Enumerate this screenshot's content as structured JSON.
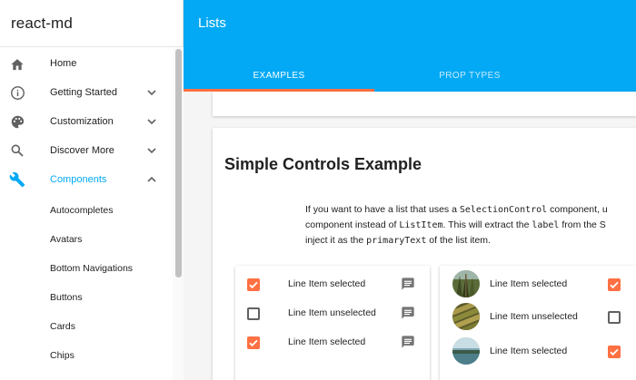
{
  "app": {
    "title": "react-md"
  },
  "sidebar": {
    "items": [
      {
        "label": "Home",
        "icon": "home-icon"
      },
      {
        "label": "Getting Started",
        "icon": "info-icon",
        "expand": "chevron-down-icon"
      },
      {
        "label": "Customization",
        "icon": "palette-icon",
        "expand": "chevron-down-icon"
      },
      {
        "label": "Discover More",
        "icon": "search-icon",
        "expand": "chevron-down-icon"
      },
      {
        "label": "Components",
        "icon": "wrench-icon",
        "expand": "chevron-up-icon",
        "active": true
      }
    ],
    "subitems": [
      "Autocompletes",
      "Avatars",
      "Bottom Navigations",
      "Buttons",
      "Cards",
      "Chips"
    ]
  },
  "header": {
    "title": "Lists",
    "tabs": [
      {
        "label": "EXAMPLES",
        "active": true
      },
      {
        "label": "PROP TYPES",
        "active": false
      }
    ]
  },
  "main": {
    "card_title": "Simple Controls Example",
    "description": {
      "line1_a": "If you want to have a list that uses a ",
      "line1_code": "SelectionControl",
      "line1_b": " component, u",
      "line2_a": "component instead of ",
      "line2_code1": "ListItem",
      "line2_b": ". This will extract the ",
      "line2_code2": "label",
      "line2_c": " from the S",
      "line3_a": "inject it as the ",
      "line3_code": "primaryText",
      "line3_b": " of the list item."
    },
    "left_list": [
      {
        "label": "Line Item selected",
        "checked": true,
        "icon": "message-icon"
      },
      {
        "label": "Line Item unselected",
        "checked": false,
        "icon": "message-icon"
      },
      {
        "label": "Line Item selected",
        "checked": true,
        "icon": "message-icon"
      }
    ],
    "right_list": [
      {
        "label": "Line Item selected",
        "checked": true,
        "avatar": "forest-avatar"
      },
      {
        "label": "Line Item unselected",
        "checked": false,
        "avatar": "field-avatar"
      },
      {
        "label": "Line Item selected",
        "checked": true,
        "avatar": "lake-avatar"
      }
    ]
  },
  "colors": {
    "primary": "#03a9f4",
    "accent": "#ff7043"
  }
}
